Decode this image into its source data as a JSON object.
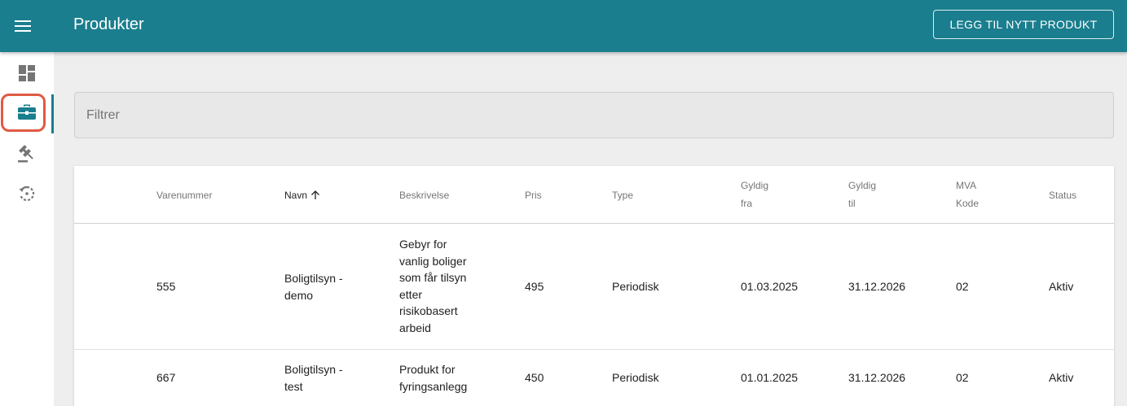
{
  "header": {
    "title": "Produkter",
    "add_button_label": "LEGG TIL NYTT PRODUKT"
  },
  "sidebar": {
    "items": [
      {
        "name": "dashboard",
        "icon": "dashboard-icon",
        "active": false
      },
      {
        "name": "products",
        "icon": "briefcase-icon",
        "active": true
      },
      {
        "name": "legal",
        "icon": "gavel-icon",
        "active": false
      },
      {
        "name": "history",
        "icon": "history-icon",
        "active": false
      }
    ]
  },
  "filter": {
    "placeholder": "Filtrer"
  },
  "table": {
    "columns": {
      "varenummer": "Varenummer",
      "navn": "Navn",
      "beskrivelse": "Beskrivelse",
      "pris": "Pris",
      "type": "Type",
      "gyldig_fra_1": "Gyldig",
      "gyldig_fra_2": "fra",
      "gyldig_til_1": "Gyldig",
      "gyldig_til_2": "til",
      "mva_1": "MVA",
      "mva_2": "Kode",
      "status": "Status"
    },
    "sort": {
      "column": "Navn",
      "direction": "ascending"
    },
    "rows": [
      {
        "varenummer": "555",
        "navn": [
          "Boligtilsyn -",
          "demo"
        ],
        "beskrivelse": [
          "Gebyr for",
          "vanlig boliger",
          "som får tilsyn",
          "etter",
          "risikobasert",
          "arbeid"
        ],
        "pris": "495",
        "type": "Periodisk",
        "gyldig_fra": "01.03.2025",
        "gyldig_til": "31.12.2026",
        "mva_kode": "02",
        "status": "Aktiv"
      },
      {
        "varenummer": "667",
        "navn": [
          "Boligtilsyn -",
          "test"
        ],
        "beskrivelse": [
          "Produkt for",
          "fyringsanlegg"
        ],
        "pris": "450",
        "type": "Periodisk",
        "gyldig_fra": "01.01.2025",
        "gyldig_til": "31.12.2026",
        "mva_kode": "02",
        "status": "Aktiv"
      }
    ]
  },
  "colors": {
    "primary": "#1a7e8e",
    "highlight": "#e05a43",
    "background": "#eeeeee"
  }
}
